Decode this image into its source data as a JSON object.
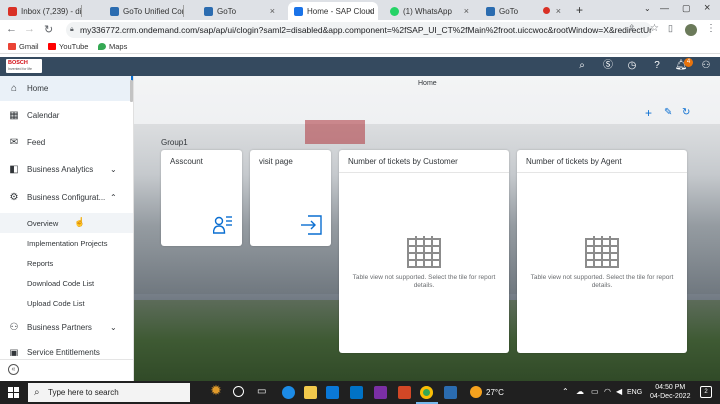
{
  "browser": {
    "tabs": [
      {
        "label": "Inbox (7,239) - div",
        "color": "#d93025"
      },
      {
        "label": "GoTo Unified Con",
        "color": "#2b6cb0"
      },
      {
        "label": "GoTo",
        "color": "#2b6cb0"
      },
      {
        "label": "Home - SAP Cloud",
        "color": "#1a73e8"
      },
      {
        "label": "(1) WhatsApp",
        "color": "#25d366"
      },
      {
        "label": "GoTo",
        "color": "#2b6cb0"
      }
    ],
    "new_tab": "+",
    "url": "my336772.crm.ondemand.com/sap/ap/ui/clogin?saml2=disabled&app.component=%2fSAP_UI_CT%2fMain%2froot.uiccwoc&rootWindow=X&redirectUrl=...",
    "bookmarks": [
      {
        "label": "Gmail",
        "color": "#ea4335"
      },
      {
        "label": "YouTube",
        "color": "#ff0000"
      },
      {
        "label": "Maps",
        "color": "#34a853"
      }
    ]
  },
  "shell": {
    "logo_text": "BOSCH",
    "logo_sub": "Invented for life",
    "notification_count": "4"
  },
  "sidebar": {
    "items": [
      {
        "label": "Home",
        "icon": "home-icon",
        "glyph": "⌂"
      },
      {
        "label": "Calendar",
        "icon": "calendar-icon",
        "glyph": "▦"
      },
      {
        "label": "Feed",
        "icon": "feed-icon",
        "glyph": "✉"
      },
      {
        "label": "Business Analytics",
        "icon": "analytics-icon",
        "glyph": "◧"
      },
      {
        "label": "Business Configurat...",
        "icon": "configuration-icon",
        "glyph": "⚙"
      }
    ],
    "subitems": [
      "Overview",
      "Implementation Projects",
      "Reports",
      "Download Code List",
      "Upload Code List"
    ],
    "more": [
      {
        "label": "Business Partners",
        "icon": "partners-icon",
        "glyph": "⚇"
      },
      {
        "label": "Service Entitlements",
        "icon": "entitlements-icon",
        "glyph": "▣"
      }
    ],
    "collapse_icon": "collapse-icon"
  },
  "main": {
    "page_title": "Home",
    "group": "Group1",
    "tiles": [
      {
        "title": "Asscount",
        "icon": "user-list-icon"
      },
      {
        "title": "visit page",
        "icon": "enter-icon"
      },
      {
        "title": "Number of tickets by Customer",
        "message": "Table view not supported. Select the tile for report details."
      },
      {
        "title": "Number of tickets by Agent",
        "message": "Table view not supported. Select the tile for report details."
      }
    ]
  },
  "taskbar": {
    "search_placeholder": "Type here to search",
    "weather": "27°C",
    "language": "ENG",
    "time": "04:50 PM",
    "date": "04-Dec-2022",
    "notification_count": "2"
  }
}
